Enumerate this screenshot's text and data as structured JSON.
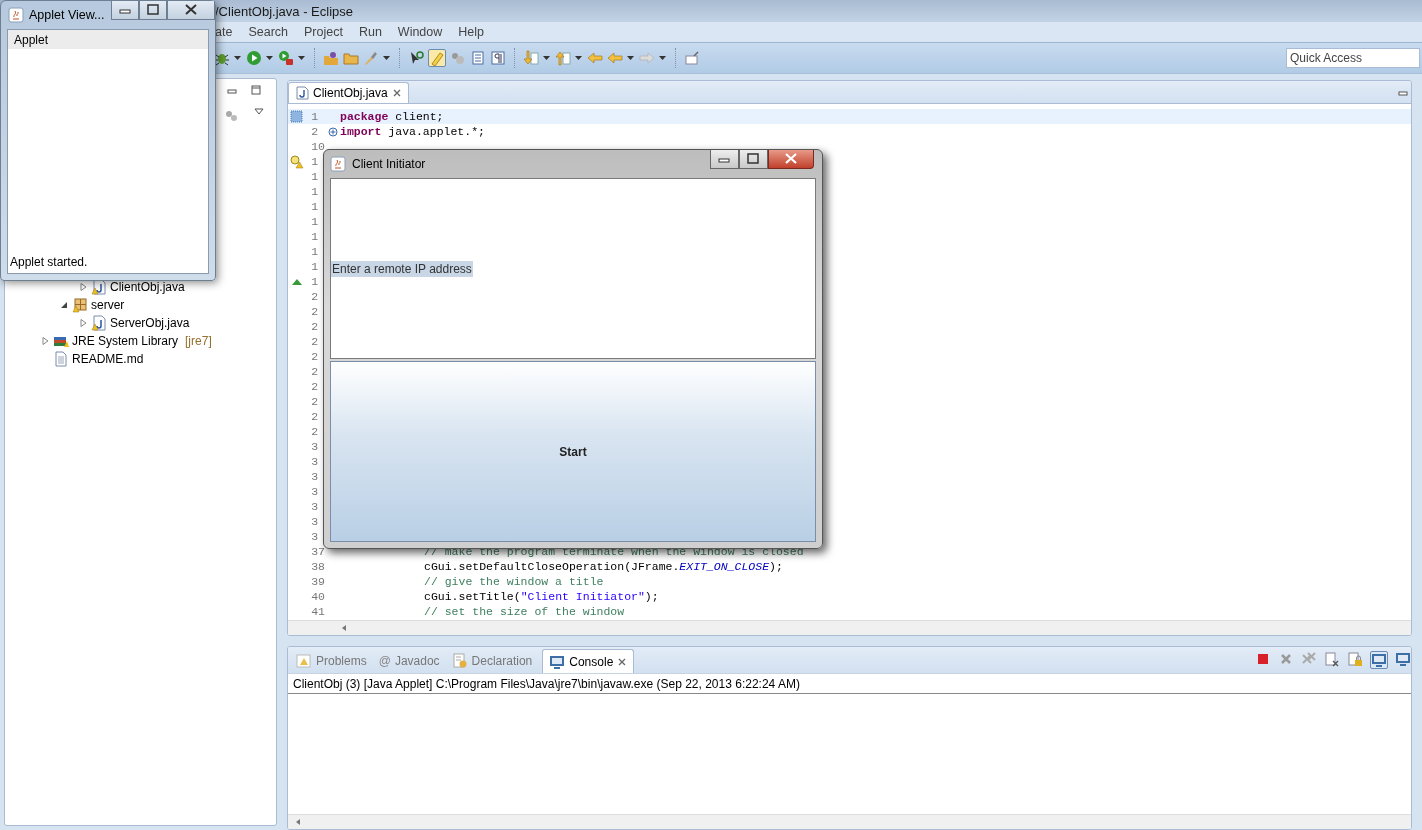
{
  "eclipse": {
    "title": "/ClientObj.java - Eclipse",
    "menu": [
      "ate",
      "Search",
      "Project",
      "Run",
      "Window",
      "Help"
    ],
    "quick_access": {
      "placeholder": "Quick Access"
    }
  },
  "package_explorer": {
    "items": [
      {
        "kind": "hidden",
        "children": [
          {
            "kind": "hidden",
            "children": [
              {
                "label": "ClientObj.java",
                "kind": "java_file",
                "expanded": false
              }
            ]
          },
          {
            "label": "server",
            "kind": "package",
            "expanded": true,
            "children": [
              {
                "label": "ServerObj.java",
                "kind": "java_file",
                "expanded": false
              }
            ]
          }
        ]
      },
      {
        "label": "JRE System Library",
        "decoration": "[jre7]",
        "kind": "library",
        "expanded": false
      },
      {
        "label": "README.md",
        "kind": "text_file"
      }
    ]
  },
  "editor": {
    "tabs": [
      {
        "label": "ClientObj.java",
        "selected": true
      }
    ],
    "lines": [
      {
        "number": "1",
        "current": true,
        "kind": "bookmark",
        "tokens": [
          {
            "text": "package",
            "kind": "keyword"
          },
          {
            "text": " client;",
            "kind": "plain"
          }
        ]
      },
      {
        "number": "2",
        "current": false,
        "kind": "folded",
        "tokens": [
          {
            "text": "import",
            "kind": "keyword"
          },
          {
            "text": " java.applet.*;",
            "kind": "plain"
          }
        ]
      },
      {
        "number": "10",
        "current": false,
        "kind": "plain"
      },
      {
        "number": "1",
        "current": false,
        "kind": "warning"
      },
      {
        "number": "1",
        "current": false,
        "kind": "plain"
      },
      {
        "number": "1",
        "current": false,
        "kind": "plain"
      },
      {
        "number": "1",
        "current": false,
        "kind": "plain"
      },
      {
        "number": "1",
        "current": false,
        "kind": "plain"
      },
      {
        "number": "1",
        "current": false,
        "kind": "plain"
      },
      {
        "number": "1",
        "current": false,
        "kind": "plain"
      },
      {
        "number": "1",
        "current": false,
        "kind": "plain"
      },
      {
        "number": "1",
        "current": false,
        "kind": "override"
      },
      {
        "number": "2",
        "current": false,
        "kind": "plain"
      },
      {
        "number": "2",
        "current": false,
        "kind": "plain"
      },
      {
        "number": "2",
        "current": false,
        "kind": "plain"
      },
      {
        "number": "2",
        "current": false,
        "kind": "plain"
      },
      {
        "number": "2",
        "current": false,
        "kind": "plain"
      },
      {
        "number": "2",
        "current": false,
        "kind": "plain"
      },
      {
        "number": "2",
        "current": false,
        "kind": "plain"
      },
      {
        "number": "2",
        "current": false,
        "kind": "plain"
      },
      {
        "number": "2",
        "current": false,
        "kind": "plain"
      },
      {
        "number": "2",
        "current": false,
        "kind": "plain"
      },
      {
        "number": "3",
        "current": false,
        "kind": "plain"
      },
      {
        "number": "3",
        "current": false,
        "kind": "plain"
      },
      {
        "number": "3",
        "current": false,
        "kind": "plain"
      },
      {
        "number": "3",
        "current": false,
        "kind": "plain"
      },
      {
        "number": "3",
        "current": false,
        "kind": "plain"
      },
      {
        "number": "3",
        "current": false,
        "kind": "plain"
      },
      {
        "number": "3",
        "current": false,
        "kind": "plain"
      },
      {
        "number": "37",
        "current": false,
        "kind": "indented",
        "tokens": [
          {
            "text": "// make the program terminate when the window is closed",
            "kind": "comment"
          }
        ]
      },
      {
        "number": "38",
        "current": false,
        "kind": "indented",
        "tokens": [
          {
            "text": "cGui.setDefaultCloseOperation(JFrame.",
            "kind": "plain"
          },
          {
            "text": "EXIT_ON_CLOSE",
            "kind": "constant"
          },
          {
            "text": ");",
            "kind": "plain"
          }
        ]
      },
      {
        "number": "39",
        "current": false,
        "kind": "indented",
        "tokens": [
          {
            "text": "// give the window a title",
            "kind": "comment"
          }
        ]
      },
      {
        "number": "40",
        "current": false,
        "kind": "indented",
        "tokens": [
          {
            "text": "cGui.setTitle(",
            "kind": "plain"
          },
          {
            "text": "\"Client Initiator\"",
            "kind": "string"
          },
          {
            "text": ");",
            "kind": "plain"
          }
        ]
      },
      {
        "number": "41",
        "current": false,
        "kind": "indented",
        "tokens": [
          {
            "text": "// set the size of the window",
            "kind": "comment"
          }
        ]
      }
    ]
  },
  "console": {
    "tabs": [
      {
        "label": "Problems",
        "kind": "problems",
        "selected": false
      },
      {
        "label": "Javadoc",
        "kind": "javadoc",
        "glyph": "@",
        "selected": false
      },
      {
        "label": "Declaration",
        "kind": "declaration",
        "selected": false
      },
      {
        "label": "Console",
        "kind": "console",
        "selected": true
      }
    ],
    "launch": "ClientObj (3) [Java Applet] C:\\Program Files\\Java\\jre7\\bin\\javaw.exe (Sep 22, 2013 6:22:24 AM)"
  },
  "applet_viewer": {
    "title": "Applet View...",
    "menu": [
      "Applet"
    ],
    "status": "Applet started."
  },
  "client_dialog": {
    "title": "Client Initiator",
    "label": "Enter a remote IP address",
    "button": "Start"
  }
}
